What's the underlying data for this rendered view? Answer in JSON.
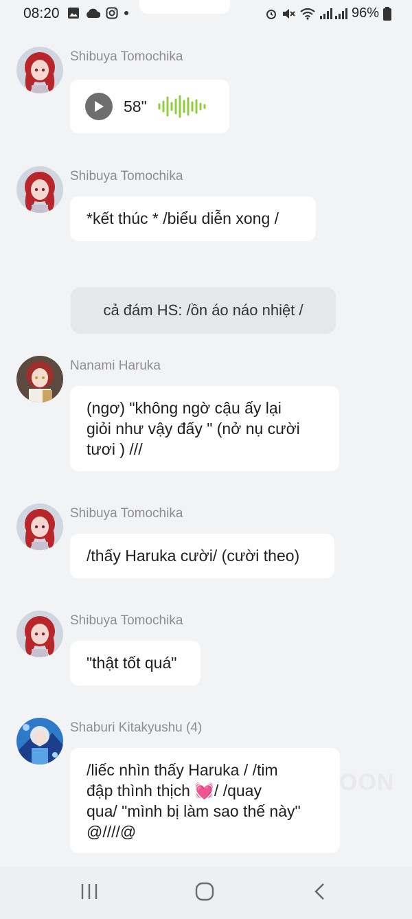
{
  "status_bar": {
    "time": "08:20",
    "battery": "96%"
  },
  "watermark": "OON",
  "voice_message": {
    "sender": "Shibuya Tomochika",
    "duration": "58\""
  },
  "messages": [
    {
      "sender": "Shibuya Tomochika",
      "text": "*kết thúc * /biểu diễn xong /"
    },
    {
      "sender": "Nanami Haruka",
      "lines": [
        "(ngơ) \"không ngờ cậu ấy lại",
        "giỏi như vậy đấy \" (nở nụ cười",
        "tươi ) ///"
      ]
    },
    {
      "sender": "Shibuya Tomochika",
      "text": "/thấy Haruka cười/ (cười theo)"
    },
    {
      "sender": "Shibuya Tomochika",
      "text": "\"thật tốt quá\""
    },
    {
      "sender": "Shaburi Kitakyushu (4)",
      "lines": [
        "/liếc nhìn thấy Haruka / /tim",
        "đập thình thịch 💓/ /quay",
        "qua/ \"mình bị làm sao thế này\"",
        "@////@"
      ]
    }
  ],
  "system_message": "cả đám HS: /ồn áo náo nhiệt /",
  "icons": {
    "status": [
      "image-icon",
      "cloud-icon",
      "instagram-icon",
      "dot-icon",
      "alarm-icon",
      "mute-icon",
      "wifi-icon",
      "signal-icon",
      "battery-icon"
    ],
    "nav": [
      "recent-apps-icon",
      "home-icon",
      "back-icon"
    ]
  }
}
